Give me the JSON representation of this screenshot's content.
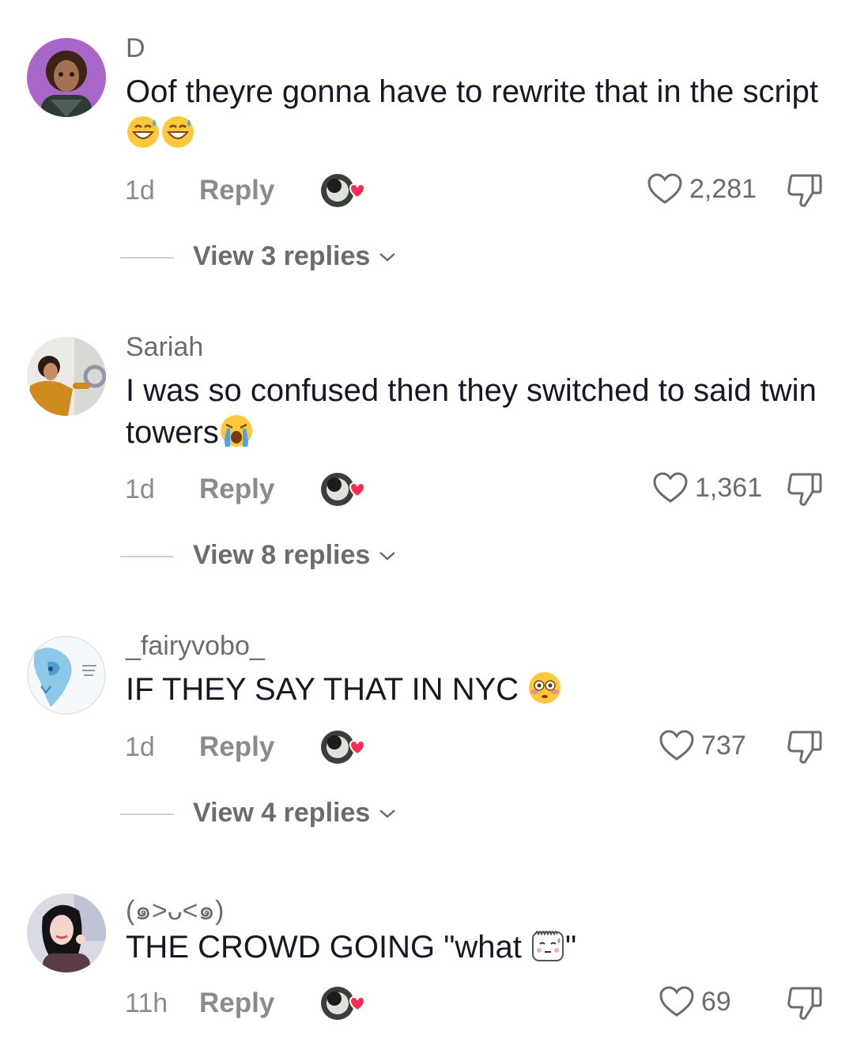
{
  "comments": [
    {
      "username": "D",
      "text": "Oof theyre gonna have to rewrite that in the script ",
      "emoji": "grinning-sweat-emoji",
      "time": "1d",
      "reply_label": "Reply",
      "likes": "2,281",
      "view_replies": "View 3 replies"
    },
    {
      "username": "Sariah",
      "text": "I was so confused then they switched to said twin towers",
      "emoji": "loudly-crying-emoji",
      "time": "1d",
      "reply_label": "Reply",
      "likes": "1,361",
      "view_replies": "View 8 replies"
    },
    {
      "username": "_fairyvobo_",
      "text": "IF THEY SAY THAT IN NYC ",
      "emoji": "flushed-emoji",
      "time": "1d",
      "reply_label": "Reply",
      "likes": "737",
      "view_replies": "View 4 replies"
    },
    {
      "username": "(๑>ᴗ<๑)",
      "text_before": "THE CROWD GOING \"what ",
      "text_after": "\"",
      "emoji": "shocked-sweat-sticker-emoji",
      "time": "11h",
      "reply_label": "Reply",
      "likes": "69"
    }
  ],
  "icons": {
    "like": "heart-outline-icon",
    "dislike": "thumbs-down-icon",
    "creator_liked": "creator-heart-badge-icon",
    "expand": "chevron-down-icon"
  },
  "colors": {
    "primary_text": "#161823",
    "secondary_text": "#8a8b91",
    "creator_heart": "#fe2c55"
  }
}
